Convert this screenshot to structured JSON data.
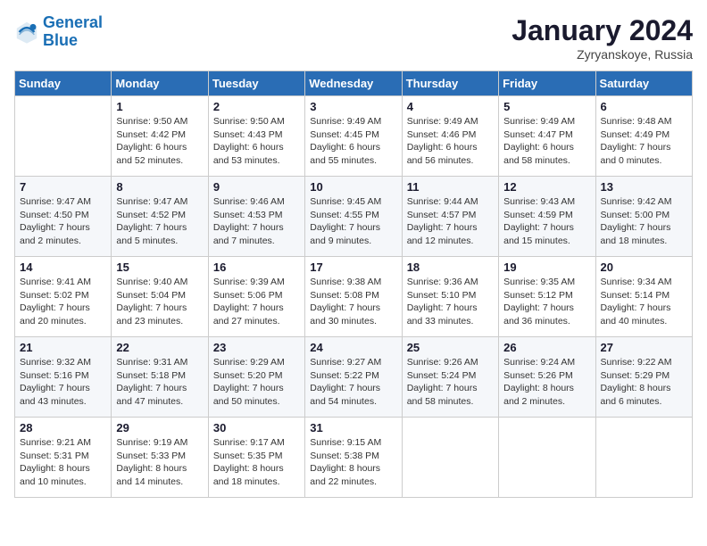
{
  "header": {
    "logo_line1": "General",
    "logo_line2": "Blue",
    "month": "January 2024",
    "location": "Zyryanskoye, Russia"
  },
  "days_of_week": [
    "Sunday",
    "Monday",
    "Tuesday",
    "Wednesday",
    "Thursday",
    "Friday",
    "Saturday"
  ],
  "weeks": [
    [
      {
        "day": "",
        "info": ""
      },
      {
        "day": "1",
        "info": "Sunrise: 9:50 AM\nSunset: 4:42 PM\nDaylight: 6 hours\nand 52 minutes."
      },
      {
        "day": "2",
        "info": "Sunrise: 9:50 AM\nSunset: 4:43 PM\nDaylight: 6 hours\nand 53 minutes."
      },
      {
        "day": "3",
        "info": "Sunrise: 9:49 AM\nSunset: 4:45 PM\nDaylight: 6 hours\nand 55 minutes."
      },
      {
        "day": "4",
        "info": "Sunrise: 9:49 AM\nSunset: 4:46 PM\nDaylight: 6 hours\nand 56 minutes."
      },
      {
        "day": "5",
        "info": "Sunrise: 9:49 AM\nSunset: 4:47 PM\nDaylight: 6 hours\nand 58 minutes."
      },
      {
        "day": "6",
        "info": "Sunrise: 9:48 AM\nSunset: 4:49 PM\nDaylight: 7 hours\nand 0 minutes."
      }
    ],
    [
      {
        "day": "7",
        "info": "Sunrise: 9:47 AM\nSunset: 4:50 PM\nDaylight: 7 hours\nand 2 minutes."
      },
      {
        "day": "8",
        "info": "Sunrise: 9:47 AM\nSunset: 4:52 PM\nDaylight: 7 hours\nand 5 minutes."
      },
      {
        "day": "9",
        "info": "Sunrise: 9:46 AM\nSunset: 4:53 PM\nDaylight: 7 hours\nand 7 minutes."
      },
      {
        "day": "10",
        "info": "Sunrise: 9:45 AM\nSunset: 4:55 PM\nDaylight: 7 hours\nand 9 minutes."
      },
      {
        "day": "11",
        "info": "Sunrise: 9:44 AM\nSunset: 4:57 PM\nDaylight: 7 hours\nand 12 minutes."
      },
      {
        "day": "12",
        "info": "Sunrise: 9:43 AM\nSunset: 4:59 PM\nDaylight: 7 hours\nand 15 minutes."
      },
      {
        "day": "13",
        "info": "Sunrise: 9:42 AM\nSunset: 5:00 PM\nDaylight: 7 hours\nand 18 minutes."
      }
    ],
    [
      {
        "day": "14",
        "info": "Sunrise: 9:41 AM\nSunset: 5:02 PM\nDaylight: 7 hours\nand 20 minutes."
      },
      {
        "day": "15",
        "info": "Sunrise: 9:40 AM\nSunset: 5:04 PM\nDaylight: 7 hours\nand 23 minutes."
      },
      {
        "day": "16",
        "info": "Sunrise: 9:39 AM\nSunset: 5:06 PM\nDaylight: 7 hours\nand 27 minutes."
      },
      {
        "day": "17",
        "info": "Sunrise: 9:38 AM\nSunset: 5:08 PM\nDaylight: 7 hours\nand 30 minutes."
      },
      {
        "day": "18",
        "info": "Sunrise: 9:36 AM\nSunset: 5:10 PM\nDaylight: 7 hours\nand 33 minutes."
      },
      {
        "day": "19",
        "info": "Sunrise: 9:35 AM\nSunset: 5:12 PM\nDaylight: 7 hours\nand 36 minutes."
      },
      {
        "day": "20",
        "info": "Sunrise: 9:34 AM\nSunset: 5:14 PM\nDaylight: 7 hours\nand 40 minutes."
      }
    ],
    [
      {
        "day": "21",
        "info": "Sunrise: 9:32 AM\nSunset: 5:16 PM\nDaylight: 7 hours\nand 43 minutes."
      },
      {
        "day": "22",
        "info": "Sunrise: 9:31 AM\nSunset: 5:18 PM\nDaylight: 7 hours\nand 47 minutes."
      },
      {
        "day": "23",
        "info": "Sunrise: 9:29 AM\nSunset: 5:20 PM\nDaylight: 7 hours\nand 50 minutes."
      },
      {
        "day": "24",
        "info": "Sunrise: 9:27 AM\nSunset: 5:22 PM\nDaylight: 7 hours\nand 54 minutes."
      },
      {
        "day": "25",
        "info": "Sunrise: 9:26 AM\nSunset: 5:24 PM\nDaylight: 7 hours\nand 58 minutes."
      },
      {
        "day": "26",
        "info": "Sunrise: 9:24 AM\nSunset: 5:26 PM\nDaylight: 8 hours\nand 2 minutes."
      },
      {
        "day": "27",
        "info": "Sunrise: 9:22 AM\nSunset: 5:29 PM\nDaylight: 8 hours\nand 6 minutes."
      }
    ],
    [
      {
        "day": "28",
        "info": "Sunrise: 9:21 AM\nSunset: 5:31 PM\nDaylight: 8 hours\nand 10 minutes."
      },
      {
        "day": "29",
        "info": "Sunrise: 9:19 AM\nSunset: 5:33 PM\nDaylight: 8 hours\nand 14 minutes."
      },
      {
        "day": "30",
        "info": "Sunrise: 9:17 AM\nSunset: 5:35 PM\nDaylight: 8 hours\nand 18 minutes."
      },
      {
        "day": "31",
        "info": "Sunrise: 9:15 AM\nSunset: 5:38 PM\nDaylight: 8 hours\nand 22 minutes."
      },
      {
        "day": "",
        "info": ""
      },
      {
        "day": "",
        "info": ""
      },
      {
        "day": "",
        "info": ""
      }
    ]
  ]
}
